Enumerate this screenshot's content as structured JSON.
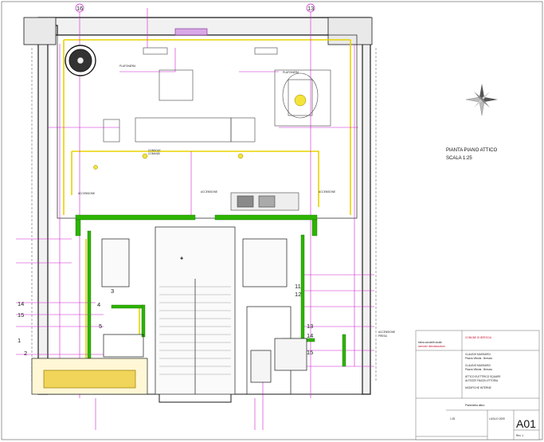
{
  "plan": {
    "title": "PIANTA PIANO ATTICO",
    "scale": "SCALA 1:25",
    "section_marks": [
      "16",
      "13"
    ],
    "callouts": [
      "14",
      "15",
      "1",
      "2",
      "3",
      "4",
      "5",
      "11",
      "12",
      "13",
      "14",
      "15"
    ],
    "annotations": {
      "acc_left": "ACCENSIONE",
      "acc_center": "ACCENSIONE",
      "acc_right": "ACCENSIONE",
      "acc_bottom": "ACCENSIONE",
      "presa": "PRESA",
      "plafoniera_1": "PLAFONIERA",
      "plafoniera_2": "PLAFONIERA",
      "console": "CONSOLE",
      "console_sub": "COMANDI"
    }
  },
  "title_block": {
    "firm_name": "elena zanoletti studio",
    "firm_sub": "lorenzini ristrutturazione",
    "client": "COMUNE DI BRESCIA",
    "fields": [
      "CLAUDIO MASSARDI",
      "Piazza Vittoria - Brescia",
      "CLAUDIO MASSARDI",
      "Piazza Vittoria - Brescia"
    ],
    "subject": [
      "ATTICO ELETTRICO SQUARE",
      "ALTEZZE PIAZZA VITTORIA",
      "MODIFICHE INTERNE"
    ],
    "stage": "Planimetria attico",
    "sheet": "A01",
    "date": "LUGLIO 2009",
    "rev": "1:25",
    "scale_note": "Rev. 1"
  },
  "colors": {
    "green": "#2db400",
    "yellow": "#e8d400",
    "magenta": "#d01fd0",
    "black": "#1a1a1a",
    "red": "#c8102e"
  }
}
